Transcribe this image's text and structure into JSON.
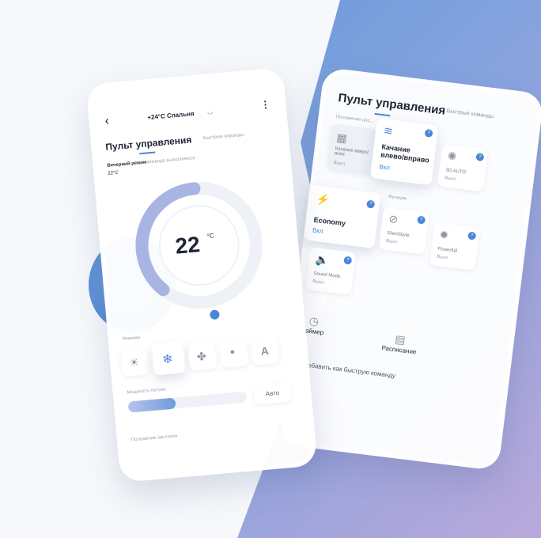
{
  "left_phone": {
    "title": "+24°C Спальня",
    "screen_title": "Пульт управления",
    "quick_commands_tab": "Быстрые команды",
    "evening_mode_label": "Вечерний режим",
    "evening_mode_sub": "команда выполняется",
    "evening_mode_temp": "22°C",
    "temperature_value": "22",
    "temperature_unit": "°C",
    "modes_label": "Режимы",
    "modes": [
      {
        "name": "sun-icon",
        "glyph": "☀"
      },
      {
        "name": "snowflake-icon",
        "glyph": "❄"
      },
      {
        "name": "fan-icon",
        "glyph": "✤"
      },
      {
        "name": "drop-icon",
        "glyph": "●"
      },
      {
        "name": "auto-icon",
        "glyph": "A"
      }
    ],
    "fan_power_label": "Мощность потока",
    "fan_power_value": "Авто",
    "fan_level": 0.4,
    "shutter_label": "Положение заслонок"
  },
  "right_phone": {
    "screen_title": "Пульт управления",
    "quick_commands_tab": "Быстрые команды",
    "shutter_label": "Положение рас...",
    "functions_label": "Функции",
    "tiles": [
      {
        "name": "tile-vertical-swing",
        "title": "Качание вверх/вниз",
        "state": "Выкл",
        "icon": "grid-icon"
      },
      {
        "name": "tile-horizontal-swing",
        "title": "Качание влево/вправо",
        "state": "Вкл",
        "icon": "swing-icon"
      },
      {
        "name": "tile-3d-auto",
        "title": "3D AUTO",
        "state": "Выкл",
        "icon": "sparkle-icon"
      },
      {
        "name": "tile-economy",
        "title": "Economy",
        "state": "Вкл",
        "icon": "bolt-icon"
      },
      {
        "name": "tile-silent",
        "title": "SilentStyle",
        "state": "Выкл",
        "icon": "mute-icon"
      },
      {
        "name": "tile-powerful",
        "title": "Powerfull",
        "state": "Выкл",
        "icon": "sun-icon"
      },
      {
        "name": "tile-sound",
        "title": "Sound Mode",
        "state": "Выкл",
        "icon": "sound-icon"
      }
    ],
    "badge_text": "?",
    "timer_label": "Таймер",
    "schedule_label": "Расписание",
    "add_quick_label": "Добавить как быструю команду"
  }
}
